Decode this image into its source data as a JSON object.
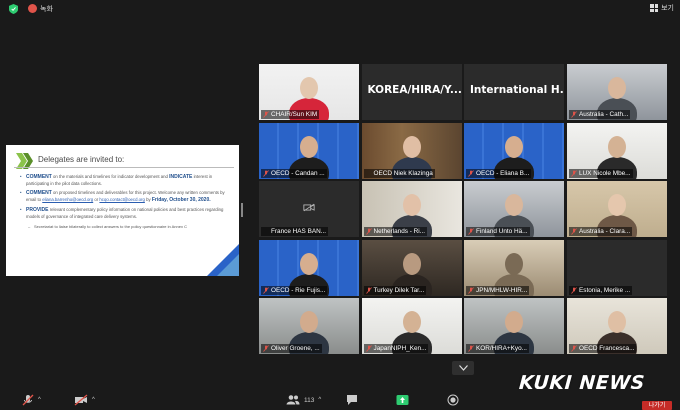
{
  "topbar": {
    "recording_label": "녹화",
    "view_label": "보기"
  },
  "shared_slide": {
    "heading": "Delegates are invited to:",
    "items": [
      {
        "keyword": "COMMENT",
        "text": " on the materials and timelines for indicator development and ",
        "keyword2": "INDICATE",
        "text2": " interest in participating in the pilot data collections."
      },
      {
        "keyword": "COMMENT",
        "text": " on proposed timelines and deliverables for this project. Welcome any written comments by email to ",
        "link1": "eliana.barrenho@oecd.org",
        "mid": " or ",
        "link2": "hcqo.contact@oecd.org",
        "end": " by ",
        "date": "Friday, October 30, 2020."
      },
      {
        "keyword": "PROVIDE",
        "text": " relevant complementary policy information on national policies and best practices regarding models of governance of integrated care delivery systems."
      }
    ],
    "sub_item": "Secretariat to liaise bilaterally to collect answers to the policy questionnaire in Annex C"
  },
  "tiles": [
    {
      "name": "CHAIR/Sun KIM",
      "muted": true,
      "type": "video",
      "scene": "chair"
    },
    {
      "name": "",
      "big_text": "KOREA/HIRA/Y...",
      "muted": false,
      "type": "text"
    },
    {
      "name": "",
      "big_text": "International H...",
      "muted": false,
      "type": "text"
    },
    {
      "name": "Australia - Cath...",
      "muted": true,
      "type": "video",
      "scene": "office"
    },
    {
      "name": "OECD - Candan ...",
      "muted": true,
      "type": "video",
      "scene": "oecd"
    },
    {
      "name": "OECD Niek Klazinga",
      "muted": false,
      "type": "video",
      "scene": "books",
      "active": true
    },
    {
      "name": "OECD - Eliana B...",
      "muted": true,
      "type": "video",
      "scene": "oecd"
    },
    {
      "name": "LUX Nicole Mbe...",
      "muted": true,
      "type": "video",
      "scene": "white"
    },
    {
      "name": "France HAS BAN...",
      "muted": false,
      "type": "video_off"
    },
    {
      "name": "Netherlands - Ri...",
      "muted": true,
      "type": "video",
      "scene": "home"
    },
    {
      "name": "Finland Unto Hä...",
      "muted": true,
      "type": "video",
      "scene": "office"
    },
    {
      "name": "Australia - Clara...",
      "muted": true,
      "type": "video",
      "scene": "beige"
    },
    {
      "name": "OECD - Rie Fujis...",
      "muted": true,
      "type": "video",
      "scene": "oecd"
    },
    {
      "name": "Turkey Dilek Tar...",
      "muted": true,
      "type": "video",
      "scene": "dark"
    },
    {
      "name": "JPN/MHLW-HIR...",
      "muted": true,
      "type": "video",
      "scene": "ceiling"
    },
    {
      "name": "Estonia, Merike ...",
      "muted": true,
      "type": "blank"
    },
    {
      "name": "Oliver Groene, ...",
      "muted": true,
      "type": "video",
      "scene": "room"
    },
    {
      "name": "JapanNIPH_Ken...",
      "muted": true,
      "type": "video",
      "scene": "white"
    },
    {
      "name": "KOR/HIRA+Kyo...",
      "muted": true,
      "type": "video",
      "scene": "room"
    },
    {
      "name": "OECD Francesca...",
      "muted": true,
      "type": "video",
      "scene": "cream"
    }
  ],
  "toolbar": {
    "participants_count": "113",
    "leave_label": "나가기"
  },
  "watermark": "KUKI NEWS",
  "colors": {
    "oecd_blue": "#2a63c8",
    "active_speaker": "#e3df3a",
    "muted_red": "#e0544a",
    "share_green": "#2ecc71"
  }
}
